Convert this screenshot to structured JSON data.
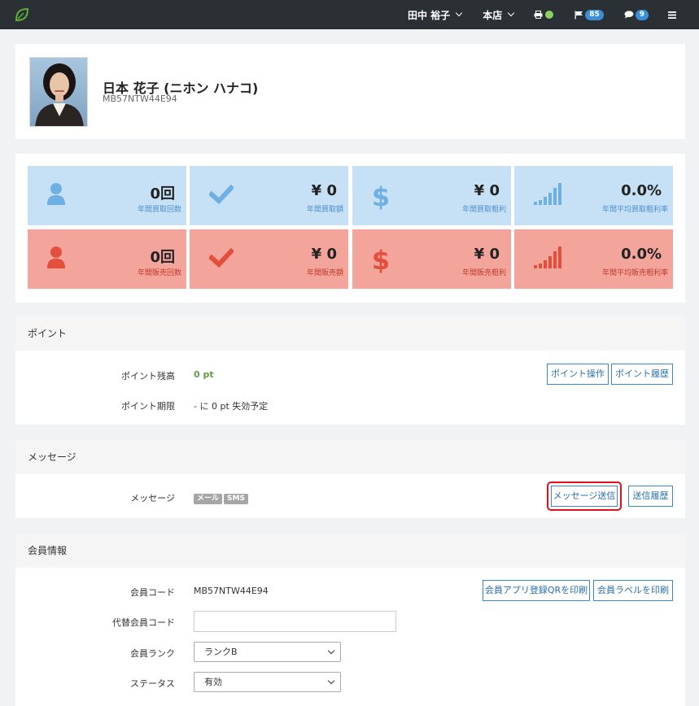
{
  "nav": {
    "user": "田中 裕子",
    "store": "本店",
    "flag_count": "85",
    "message_count": "9"
  },
  "profile": {
    "name": "日本 花子 (ニホン ハナコ)",
    "code": "MB57NTW44E94"
  },
  "stats": {
    "buy": [
      {
        "value": "0回",
        "label": "年間買取回数",
        "icon": "user-icon"
      },
      {
        "value": "¥ 0",
        "label": "年間買取額",
        "icon": "check-icon"
      },
      {
        "value": "¥ 0",
        "label": "年間買取粗利",
        "icon": "dollar-icon"
      },
      {
        "value": "0.0%",
        "label": "年間平均買取粗利率",
        "icon": "signal-bars-icon"
      }
    ],
    "sell": [
      {
        "value": "0回",
        "label": "年間販売回数",
        "icon": "user-icon"
      },
      {
        "value": "¥ 0",
        "label": "年間販売額",
        "icon": "check-icon"
      },
      {
        "value": "¥ 0",
        "label": "年間販売粗利",
        "icon": "dollar-icon"
      },
      {
        "value": "0.0%",
        "label": "年間平均販売粗利率",
        "icon": "signal-bars-icon"
      }
    ]
  },
  "points": {
    "title": "ポイント",
    "balance_label": "ポイント残高",
    "balance_value": "0 pt",
    "expiry_label": "ポイント期限",
    "expiry_value": "- に 0 pt 失効予定",
    "operate_button": "ポイント操作",
    "history_button": "ポイント履歴"
  },
  "messages": {
    "title": "メッセージ",
    "label": "メッセージ",
    "tag_mail": "メール",
    "tag_sms": "SMS",
    "send_button": "メッセージ送信",
    "history_button": "送信履歴"
  },
  "member": {
    "title": "会員情報",
    "code_label": "会員コード",
    "code_value": "MB57NTW44E94",
    "print_qr_button": "会員アプリ登録QRを印刷",
    "print_label_button": "会員ラベルを印刷",
    "alt_code_label": "代替会員コード",
    "alt_code_value": "",
    "rank_label": "会員ランク",
    "rank_value": "ランクB",
    "status_label": "ステータス",
    "status_value": "有効"
  },
  "colors": {
    "topbar": "#2b3035",
    "stat_blue": "#c6e0f6",
    "stat_red": "#f3a59c",
    "accent_blue": "#3b87c8",
    "highlight_red": "#e0101a",
    "point_green": "#5f9e47"
  }
}
